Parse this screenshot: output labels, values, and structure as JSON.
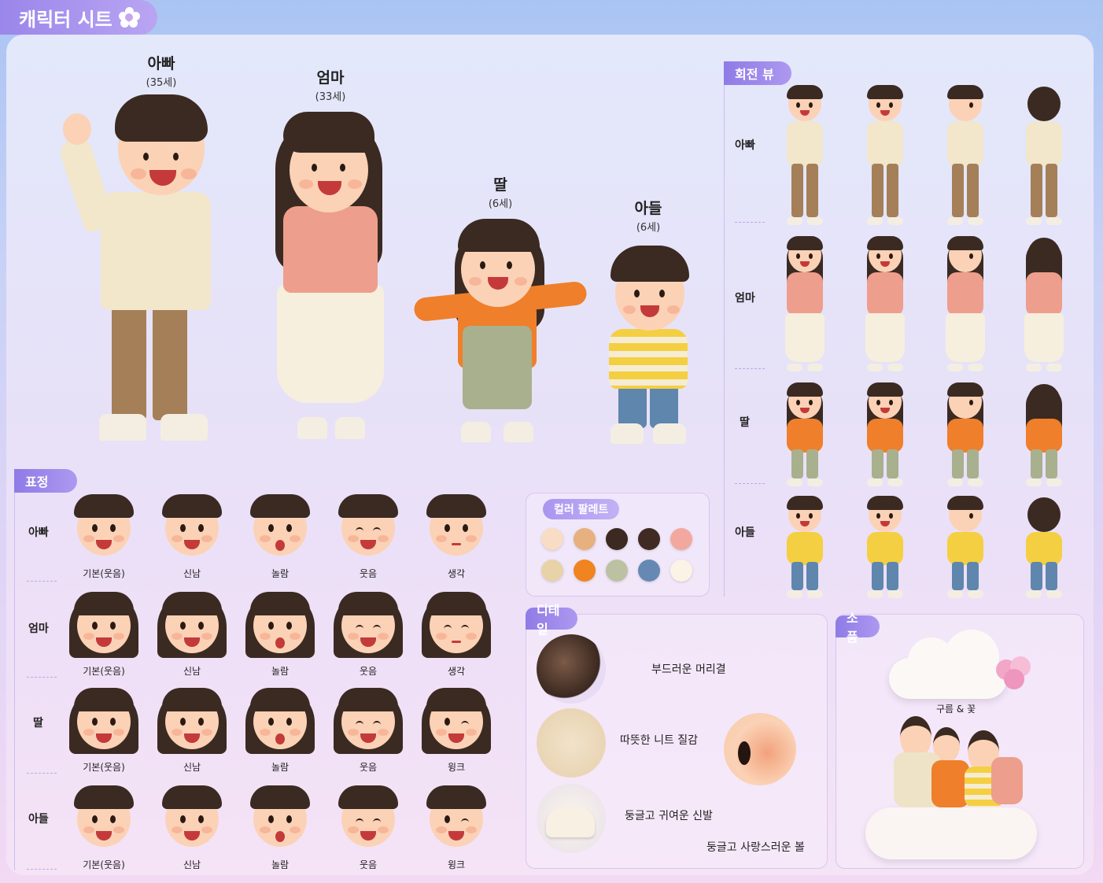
{
  "title": "캐릭터 시트",
  "heroes": [
    {
      "name": "아빠",
      "age": "(35세)"
    },
    {
      "name": "엄마",
      "age": "(33세)"
    },
    {
      "name": "딸",
      "age": "(6세)"
    },
    {
      "name": "아들",
      "age": "(6세)"
    }
  ],
  "rotation": {
    "tag": "회전 뷰",
    "rows": [
      "아빠",
      "엄마",
      "딸",
      "아들"
    ]
  },
  "expressions": {
    "tag": "표정",
    "rows": [
      {
        "label": "아빠",
        "captions": [
          "기본(웃음)",
          "신남",
          "놀람",
          "웃음",
          "생각"
        ]
      },
      {
        "label": "엄마",
        "captions": [
          "기본(웃음)",
          "신남",
          "놀람",
          "웃음",
          "생각"
        ]
      },
      {
        "label": "딸",
        "captions": [
          "기본(웃음)",
          "신남",
          "놀람",
          "웃음",
          "윙크"
        ]
      },
      {
        "label": "아들",
        "captions": [
          "기본(웃음)",
          "신남",
          "놀람",
          "웃음",
          "윙크"
        ]
      }
    ]
  },
  "palette": {
    "title": "컬러 팔레트",
    "colors": [
      "#f8dcc4",
      "#e6b07f",
      "#3c2a22",
      "#3f2b24",
      "#f3a89f",
      "#e8d3a8",
      "#f08421",
      "#bcc1a2",
      "#6689b3",
      "#fbf3e6"
    ]
  },
  "details": {
    "tag": "디테일",
    "items": [
      "부드러운 머리결",
      "따뜻한 니트 질감",
      "둥글고 귀여운 신발",
      "둥글고 사랑스러운 볼"
    ]
  },
  "props": {
    "tag": "소품",
    "caption": "구름 & 꽃"
  }
}
